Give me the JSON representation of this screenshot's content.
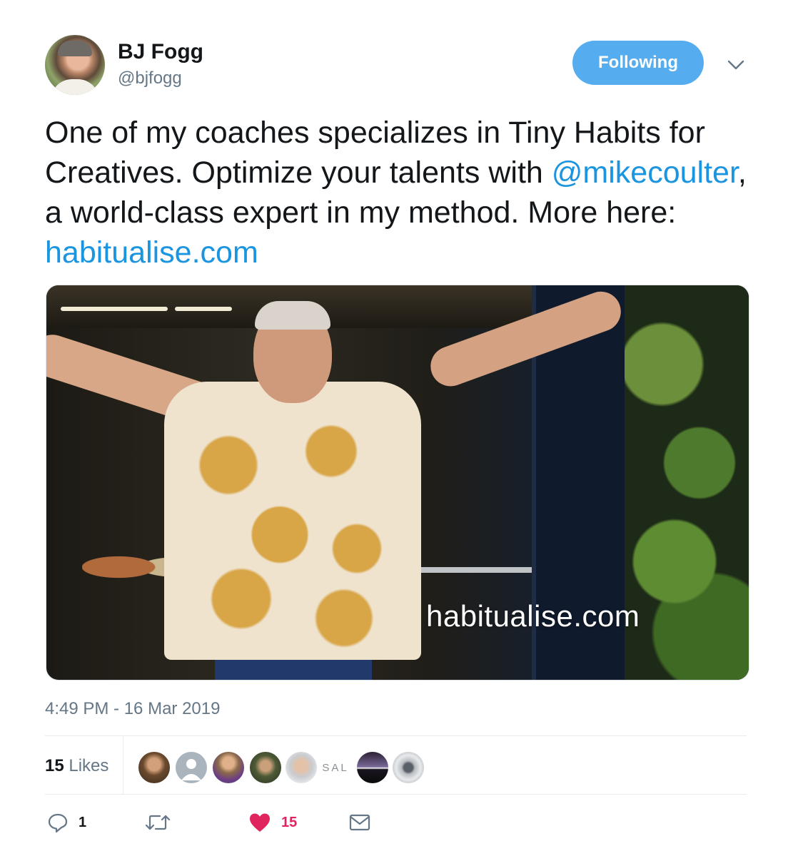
{
  "header": {
    "name": "BJ Fogg",
    "handle": "@bjfogg",
    "follow_label": "Following"
  },
  "tweet": {
    "part1": "One of my coaches specializes in Tiny Habits for Creatives. Optimize your talents with ",
    "mention": "@mikecoulter",
    "part2": ", a world-class expert in my method. More here: ",
    "link": "habitualise.com"
  },
  "media": {
    "watermark": "habitualise.com"
  },
  "meta": {
    "timestamp": "4:49 PM - 16 Mar 2019",
    "likes_count": "15",
    "likes_label": "Likes"
  },
  "likers": [
    {
      "name": "liker-1",
      "color": "#6b4a2e"
    },
    {
      "name": "liker-2",
      "color": "#aab4bd"
    },
    {
      "name": "liker-3",
      "color": "#8a6a4a"
    },
    {
      "name": "liker-4",
      "color": "#4d5a36"
    },
    {
      "name": "liker-5",
      "color": "#c9ccd0"
    },
    {
      "name": "liker-6",
      "text": "SAL"
    },
    {
      "name": "liker-7",
      "color": "#1a1520"
    },
    {
      "name": "liker-8",
      "color": "#b8bcc0"
    }
  ],
  "actions": {
    "reply_count": "1",
    "retweet_count": "",
    "like_count": "15"
  },
  "colors": {
    "accent": "#1b95e0",
    "follow_bg": "#55acee",
    "like_red": "#e0245e",
    "muted": "#657786"
  },
  "icons": [
    "chevron-down-icon",
    "reply-icon",
    "retweet-icon",
    "heart-icon",
    "mail-icon"
  ]
}
